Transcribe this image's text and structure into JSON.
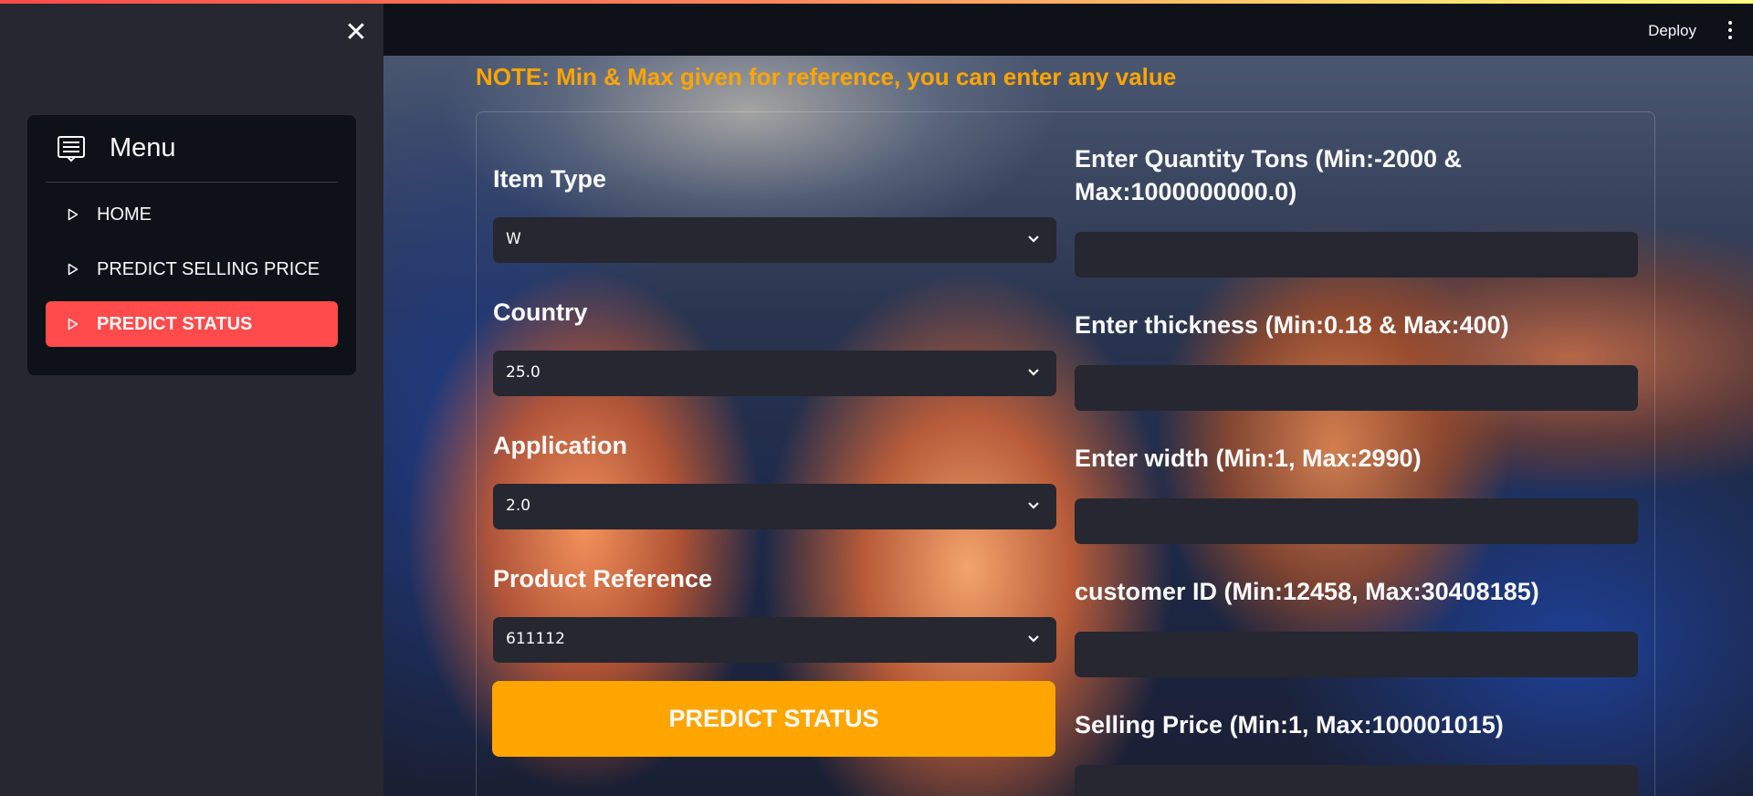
{
  "header": {
    "deploy_label": "Deploy",
    "menu_icon": "kebab-menu-icon"
  },
  "sidebar": {
    "close_icon": "close-icon",
    "menu": {
      "icon": "menu-list-icon",
      "title": "Menu",
      "items": [
        {
          "label": "HOME",
          "icon": "play-outline-icon",
          "active": false
        },
        {
          "label": "PREDICT SELLING PRICE",
          "icon": "play-outline-icon",
          "active": false
        },
        {
          "label": "PREDICT STATUS",
          "icon": "play-outline-icon",
          "active": true
        }
      ],
      "active_color": "#ff4b4b"
    }
  },
  "main": {
    "note": "NOTE: Min & Max given for reference, you can enter any value",
    "note_color": "#ffa500",
    "left_fields": [
      {
        "label": "Item Type",
        "value": "W"
      },
      {
        "label": "Country",
        "value": "25.0"
      },
      {
        "label": "Application",
        "value": "2.0"
      },
      {
        "label": "Product Reference",
        "value": "611112"
      }
    ],
    "right_fields": [
      {
        "label": "Enter Quantity Tons (Min:-2000 & Max:1000000000.0)",
        "value": ""
      },
      {
        "label": "Enter thickness (Min:0.18 & Max:400)",
        "value": ""
      },
      {
        "label": "Enter width (Min:1, Max:2990)",
        "value": ""
      },
      {
        "label": "customer ID (Min:12458, Max:30408185)",
        "value": ""
      },
      {
        "label": "Selling Price (Min:1, Max:100001015)",
        "value": ""
      }
    ],
    "submit_label": "PREDICT STATUS",
    "submit_color": "#ffa500"
  }
}
